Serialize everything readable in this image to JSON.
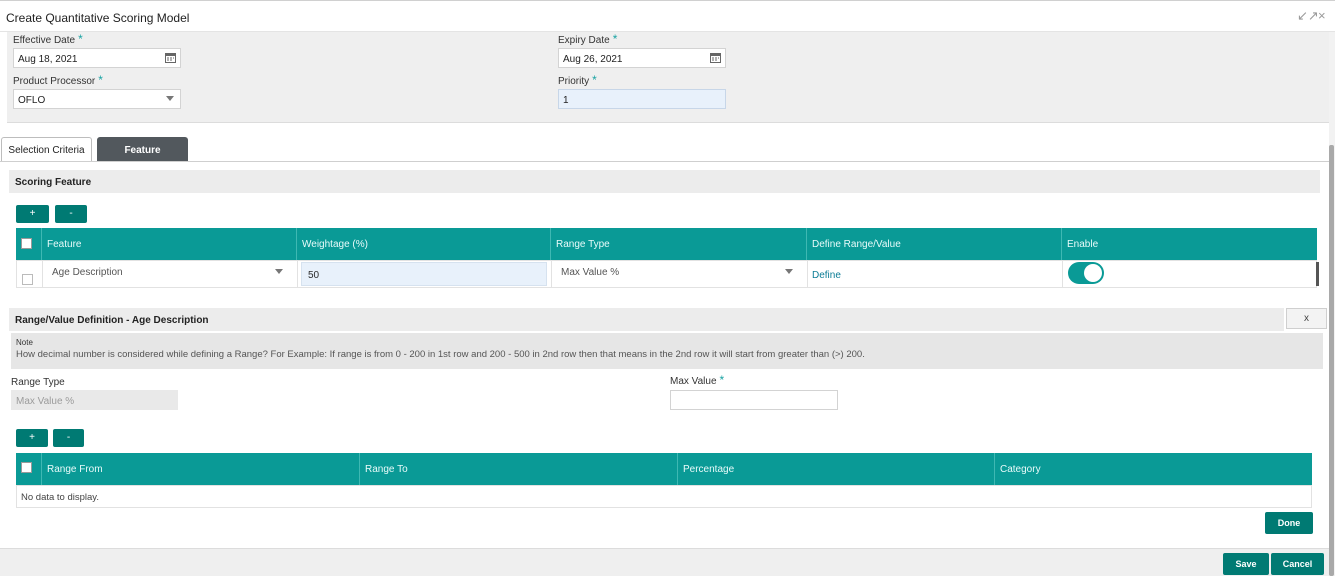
{
  "window": {
    "title": "Create Quantitative Scoring Model",
    "restore_icon": "↙↗",
    "close_icon": "×"
  },
  "form": {
    "effective_date": {
      "label": "Effective Date",
      "required": "*",
      "value": "Aug 18, 2021",
      "icon": "calendar-icon"
    },
    "expiry_date": {
      "label": "Expiry Date",
      "required": "*",
      "value": "Aug 26, 2021",
      "icon": "calendar-icon"
    },
    "product_processor": {
      "label": "Product Processor",
      "required": "*",
      "value": "OFLO"
    },
    "priority": {
      "label": "Priority",
      "required": "*",
      "value": "1"
    }
  },
  "tabs": [
    {
      "label": "Selection Criteria",
      "active": false
    },
    {
      "label": "Feature",
      "active": true
    }
  ],
  "scoring_feature": {
    "title": "Scoring Feature",
    "add_label": "+",
    "remove_label": "-",
    "columns": [
      "Feature",
      "Weightage (%)",
      "Range Type",
      "Define Range/Value",
      "Enable"
    ],
    "rows": [
      {
        "feature": "Age Description",
        "weightage": "50",
        "range_type": "Max Value %",
        "define": "Define",
        "enabled": true
      }
    ]
  },
  "range_definition": {
    "title": "Range/Value Definition - Age Description",
    "close_label": "x",
    "note_title": "Note",
    "note_body": "How decimal number is considered while defining a Range? For Example: If range is from 0 - 200 in 1st row and 200 - 500 in 2nd row then that means in the 2nd row it will start from greater than (>) 200.",
    "range_type_label": "Range Type",
    "range_type_value": "Max Value %",
    "max_value_label": "Max Value",
    "max_value_required": "*",
    "max_value_value": "",
    "add_label": "+",
    "remove_label": "-",
    "columns": [
      "Range From",
      "Range To",
      "Percentage",
      "Category"
    ],
    "empty_text": "No data to display.",
    "done_label": "Done"
  },
  "footer": {
    "save_label": "Save",
    "cancel_label": "Cancel"
  },
  "colors": {
    "accent": "#0a9a96",
    "button": "#007a73",
    "tab_active": "#52585d",
    "link": "#0b7c95"
  }
}
